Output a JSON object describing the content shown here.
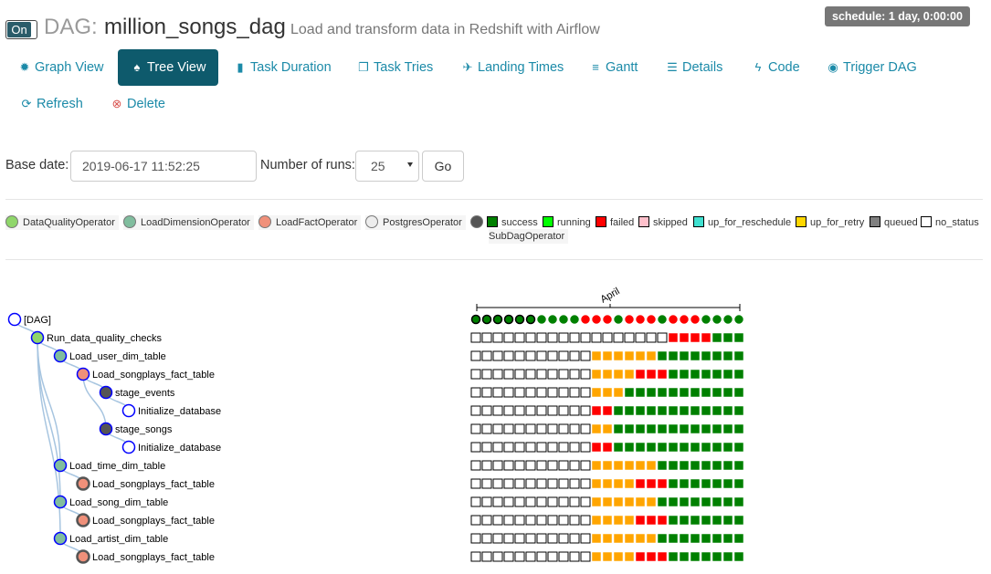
{
  "header": {
    "toggle_label": "On",
    "dag_prefix": "DAG:",
    "dag_name": "million_songs_dag",
    "description": "Load and transform data in Redshift with Airflow",
    "schedule": "schedule: 1 day, 0:00:00"
  },
  "nav": {
    "graph_view": "Graph View",
    "tree_view": "Tree View",
    "task_duration": "Task Duration",
    "task_tries": "Task Tries",
    "landing_times": "Landing Times",
    "gantt": "Gantt",
    "details": "Details",
    "code": "Code",
    "trigger_dag": "Trigger DAG",
    "refresh": "Refresh",
    "delete": "Delete"
  },
  "form": {
    "base_date_label": "Base date:",
    "base_date_value": "2019-06-17 11:52:25",
    "num_runs_label": "Number of runs:",
    "num_runs_value": "25",
    "go_label": "Go"
  },
  "legend": {
    "operators": [
      {
        "name": "DataQualityOperator",
        "color": "#8fd66a"
      },
      {
        "name": "LoadDimensionOperator",
        "color": "#80bd9e"
      },
      {
        "name": "LoadFactOperator",
        "color": "#f0907a"
      },
      {
        "name": "PostgresOperator",
        "color": "#ededed"
      },
      {
        "name": "SubDagOperator",
        "color": "#555555"
      }
    ],
    "states": [
      {
        "name": "success",
        "color": "#008000"
      },
      {
        "name": "running",
        "color": "#00ff00"
      },
      {
        "name": "failed",
        "color": "#ff0000"
      },
      {
        "name": "skipped",
        "color": "#ffc0cb"
      },
      {
        "name": "up_for_reschedule",
        "color": "#40e0d0"
      },
      {
        "name": "up_for_retry",
        "color": "#ffd700"
      },
      {
        "name": "queued",
        "color": "#808080"
      },
      {
        "name": "no_status",
        "color": "#ffffff"
      }
    ]
  },
  "timeline": {
    "month_label": "April"
  },
  "tree": {
    "nodes": [
      {
        "label": "[DAG]",
        "depth": 0,
        "fill": "#ffffff",
        "stroke": "#0000ff",
        "parent": null
      },
      {
        "label": "Run_data_quality_checks",
        "depth": 1,
        "fill": "#8fd66a",
        "stroke": "#0000ff",
        "parent": 0
      },
      {
        "label": "Load_user_dim_table",
        "depth": 2,
        "fill": "#80bd9e",
        "stroke": "#0000ff",
        "parent": 1
      },
      {
        "label": "Load_songplays_fact_table",
        "depth": 3,
        "fill": "#f0907a",
        "stroke": "#0000ff",
        "parent": 2
      },
      {
        "label": "stage_events",
        "depth": 4,
        "fill": "#555555",
        "stroke": "#0000ff",
        "parent": 3
      },
      {
        "label": "Initialize_database",
        "depth": 5,
        "fill": "#ffffff",
        "stroke": "#0000ff",
        "parent": 4
      },
      {
        "label": "stage_songs",
        "depth": 4,
        "fill": "#555555",
        "stroke": "#0000ff",
        "parent": 3
      },
      {
        "label": "Initialize_database",
        "depth": 5,
        "fill": "#ffffff",
        "stroke": "#0000ff",
        "parent": 6
      },
      {
        "label": "Load_time_dim_table",
        "depth": 2,
        "fill": "#80bd9e",
        "stroke": "#0000ff",
        "parent": 1
      },
      {
        "label": "Load_songplays_fact_table",
        "depth": 3,
        "fill": "#f0907a",
        "stroke": "#555555",
        "parent": 8
      },
      {
        "label": "Load_song_dim_table",
        "depth": 2,
        "fill": "#80bd9e",
        "stroke": "#0000ff",
        "parent": 1
      },
      {
        "label": "Load_songplays_fact_table",
        "depth": 3,
        "fill": "#f0907a",
        "stroke": "#555555",
        "parent": 10
      },
      {
        "label": "Load_artist_dim_table",
        "depth": 2,
        "fill": "#80bd9e",
        "stroke": "#0000ff",
        "parent": 1
      },
      {
        "label": "Load_songplays_fact_table",
        "depth": 3,
        "fill": "#f0907a",
        "stroke": "#555555",
        "parent": 12
      }
    ],
    "dag_runs": "SSSSSSGGGGRRRGRRRGRRRGGGG",
    "dag_run_bold_count": 6,
    "task_rows": [
      "WWWWWWWWWWWWWWWWWWRRRRGGG",
      "WWWWWWWWWWWOOOOOOGGGGGGGG",
      "WWWWWWWWWWWOOOORRRGGGGGGG",
      "WWWWWWWWWWWOOOGGGGGGGGGGG",
      "WWWWWWWWWWWRRGGGGGGGGGGGG",
      "WWWWWWWWWWWOOGGGGGGGGGGGG",
      "WWWWWWWWWWWRRGGGGGGGGGGGG",
      "WWWWWWWWWWWOOOOOOGGGGGGGG",
      "WWWWWWWWWWWOOOORRRGGGGGGG",
      "WWWWWWWWWWWOOOOOOGGGGGGGG",
      "WWWWWWWWWWWOOOORRRGGGGGGG",
      "WWWWWWWWWWWOOOOOOGGGGGGGG",
      "WWWWWWWWWWWOOOORRRGGGGGGG"
    ],
    "cell_colors": {
      "W": "#ffffff",
      "O": "#ffa500",
      "R": "#ff0000",
      "G": "#008000",
      "S": "#008000"
    }
  }
}
